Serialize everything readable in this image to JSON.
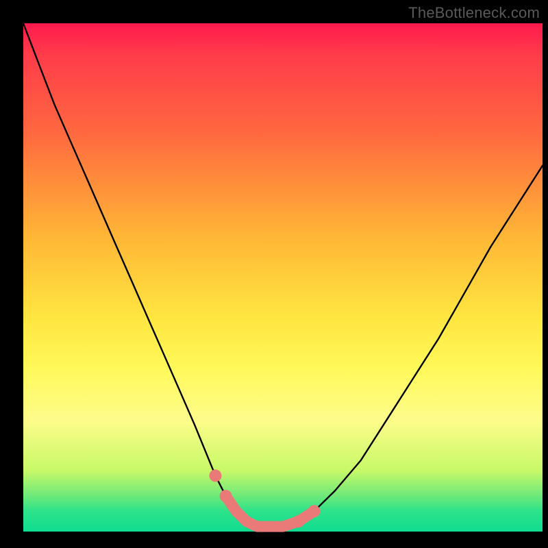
{
  "watermark": "TheBottleneck.com",
  "colors": {
    "curve": "#000000",
    "highlight": "#e97a78",
    "gradient_top": "#ff1a4d",
    "gradient_mid": "#ffe640",
    "gradient_bottom": "#0fdc90"
  },
  "chart_data": {
    "type": "line",
    "title": "",
    "xlabel": "",
    "ylabel": "",
    "xlim": [
      0,
      100
    ],
    "ylim": [
      0,
      100
    ],
    "grid": false,
    "series": [
      {
        "name": "bottleneck_curve",
        "x": [
          0,
          3,
          6,
          9,
          12,
          15,
          18,
          21,
          24,
          27,
          30,
          33,
          35,
          37,
          39,
          41,
          43,
          45,
          47,
          50,
          53,
          56,
          60,
          65,
          70,
          75,
          80,
          85,
          90,
          95,
          100
        ],
        "y": [
          100,
          92,
          84,
          77,
          70,
          63,
          56,
          49,
          42,
          35,
          28,
          21,
          16,
          11,
          7,
          4,
          2,
          1,
          1,
          1,
          2,
          4,
          8,
          14,
          22,
          30,
          38,
          47,
          56,
          64,
          72
        ]
      }
    ],
    "highlight_range": {
      "x": [
        39,
        41,
        43,
        45,
        47,
        50,
        53,
        56
      ],
      "y": [
        7,
        4,
        2,
        1,
        1,
        1,
        2,
        4
      ]
    },
    "highlight_markers": {
      "x": [
        37,
        39,
        53,
        56
      ],
      "y": [
        11,
        7,
        2,
        4
      ]
    }
  }
}
